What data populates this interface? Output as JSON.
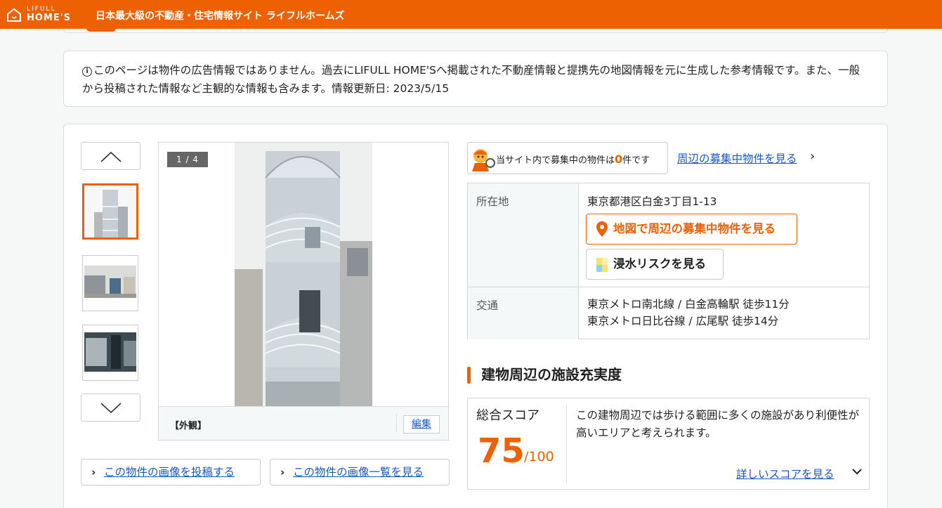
{
  "header": {
    "logo_top": "LIFULL",
    "logo_bottom": "HOME'S",
    "tagline": "日本最大級の不動産・住宅情報サイト ライフルホームズ"
  },
  "notice": {
    "icon": "info-icon",
    "text": "このページは物件の広告情報ではありません。過去にLIFULL HOME'Sへ掲載された不動産情報と提携先の地図情報を元に生成した参考情報です。また、一般から投稿された情報など主観的な情報も含みます。情報更新日: 2023/5/15"
  },
  "gallery": {
    "counter": "1 / 4",
    "caption": "【外観】",
    "edit_label": "編集",
    "post_image_label": "この物件の画像を投稿する",
    "image_list_label": "この物件の画像一覧を見る"
  },
  "promo": {
    "text_before": "当サイト内で募集中の物件は",
    "count": "0",
    "text_after": "件です",
    "link_label": "周辺の募集中物件を見る"
  },
  "details": {
    "location_label": "所在地",
    "address": "東京都港区白金3丁目1-13",
    "map_button_label": "地図で周辺の募集中物件を見る",
    "flood_button_label": "浸水リスクを見る",
    "transport_label": "交通",
    "transport_lines": [
      "東京メトロ南北線 / 白金高輪駅 徒歩11分",
      "東京メトロ日比谷線 / 広尾駅 徒歩14分"
    ]
  },
  "facilities": {
    "section_title": "建物周辺の施設充実度",
    "score_label": "総合スコア",
    "score_value": "75",
    "score_max": "/100",
    "description": "この建物周辺では歩ける範囲に多くの施設があり利便性が高いエリアと考えられます。",
    "more_link_label": "詳しいスコアを見る"
  },
  "colors": {
    "brand_orange": "#ed6103",
    "link_blue": "#1a58c4"
  }
}
